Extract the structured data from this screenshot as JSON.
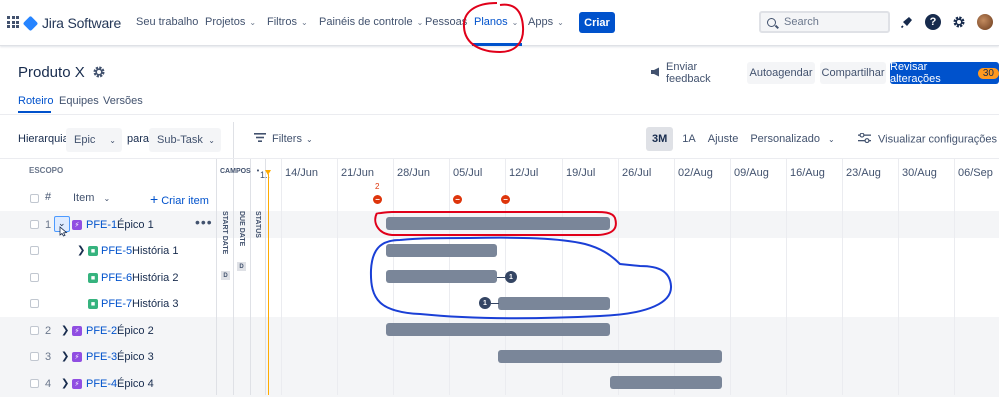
{
  "topnav": {
    "product": "Jira Software",
    "items": [
      {
        "label": "Seu trabalho",
        "dropdown": false
      },
      {
        "label": "Projetos",
        "dropdown": true
      },
      {
        "label": "Filtros",
        "dropdown": true
      },
      {
        "label": "Painéis de controle",
        "dropdown": true
      },
      {
        "label": "Pessoas",
        "dropdown": false
      },
      {
        "label": "Planos",
        "dropdown": true,
        "active": true
      },
      {
        "label": "Apps",
        "dropdown": true
      }
    ],
    "create_label": "Criar",
    "search_placeholder": "Search",
    "icons": [
      "notifications-icon",
      "help-icon",
      "settings-icon",
      "avatar"
    ],
    "help_glyph": "?"
  },
  "header": {
    "title": "Produto X",
    "feedback_label": "Enviar feedback",
    "schedule_label": "Autoagendar",
    "share_label": "Compartilhar",
    "review_label": "Revisar alterações",
    "review_count": "30"
  },
  "tabs": [
    {
      "label": "Roteiro",
      "active": true
    },
    {
      "label": "Equipes",
      "active": false
    },
    {
      "label": "Versões",
      "active": false
    }
  ],
  "toolbar": {
    "hierarchy_label": "Hierarquia:",
    "hierarchy_from": "Epic",
    "hierarchy_to_label": "para",
    "hierarchy_to": "Sub-Task",
    "filters_label": "Filters",
    "ranges": [
      {
        "label": "3M",
        "selected": true
      },
      {
        "label": "1A",
        "selected": false
      },
      {
        "label": "Ajuste",
        "selected": false
      },
      {
        "label": "Personalizado",
        "selected": false
      }
    ],
    "view_settings_label": "Visualizar configurações"
  },
  "grid": {
    "scope_header": "ESCOPO",
    "number_header": "#",
    "item_header": "Item",
    "create_item_label": "Criar item",
    "fields_header": "CAMPOS",
    "field_columns": [
      "START DATE",
      "DUE DATE",
      "STATUS"
    ],
    "field_date_tag": "D",
    "collapsed_column_label": "1.."
  },
  "timeline": {
    "months": [
      "14/Jun",
      "21/Jun",
      "28/Jun",
      "05/Jul",
      "12/Jul",
      "19/Jul",
      "26/Jul",
      "02/Aug",
      "09/Aug",
      "16/Aug",
      "23/Aug",
      "30/Aug",
      "06/Sep"
    ],
    "marker_count": "2",
    "marker_glyph": "−"
  },
  "rows": [
    {
      "num": "1",
      "key": "PFE-1",
      "title": "Épico 1",
      "type": "epic",
      "expanded": true,
      "has_menu": true,
      "dep": ""
    },
    {
      "num": "",
      "key": "PFE-5",
      "title": "História 1",
      "type": "story",
      "expanded": false,
      "has_menu": false,
      "dep": ""
    },
    {
      "num": "",
      "key": "PFE-6",
      "title": "História 2",
      "type": "story",
      "expanded": false,
      "has_menu": false,
      "dep": "1"
    },
    {
      "num": "",
      "key": "PFE-7",
      "title": "História 3",
      "type": "story",
      "expanded": false,
      "has_menu": false,
      "dep": "1"
    },
    {
      "num": "2",
      "key": "PFE-2",
      "title": "Épico 2",
      "type": "epic",
      "expanded": false,
      "has_menu": false,
      "dep": ""
    },
    {
      "num": "3",
      "key": "PFE-3",
      "title": "Épico 3",
      "type": "epic",
      "expanded": false,
      "has_menu": false,
      "dep": ""
    },
    {
      "num": "4",
      "key": "PFE-4",
      "title": "Épico 4",
      "type": "epic",
      "expanded": false,
      "has_menu": false,
      "dep": ""
    }
  ],
  "colors": {
    "brand_blue": "#0052cc",
    "bar_gray": "#7a8699",
    "epic_purple": "#904ee2",
    "story_green": "#36b37e",
    "annotation_red": "#e0001a",
    "annotation_blue": "#1a3fd6",
    "today_marker": "#ffab00",
    "review_badge": "#ff991f"
  }
}
